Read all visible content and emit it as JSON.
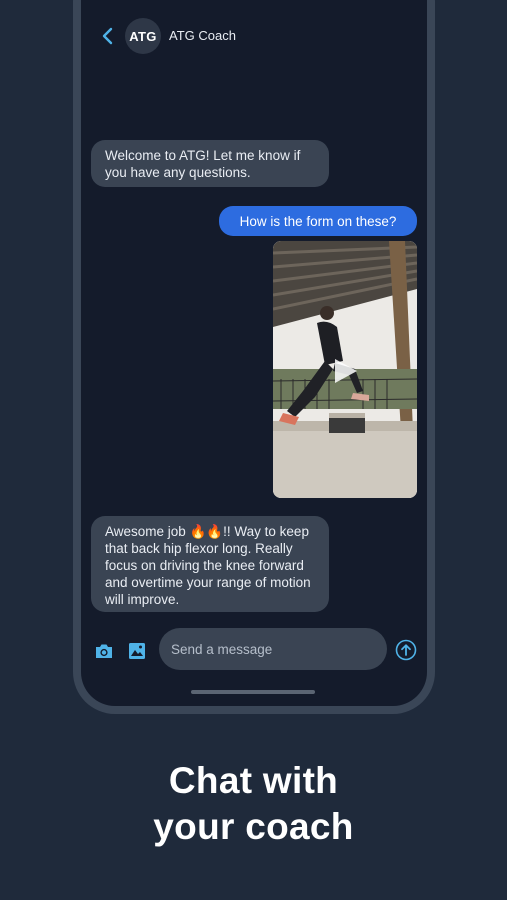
{
  "header": {
    "avatar_text": "ATG",
    "coach_name": "ATG Coach"
  },
  "messages": [
    {
      "sender": "coach",
      "text": "Welcome to ATG! Let me know if you have any questions."
    },
    {
      "sender": "user",
      "text": "How is the form on these?"
    },
    {
      "sender": "user",
      "type": "video"
    },
    {
      "sender": "coach",
      "text": "Awesome job 🔥🔥!! Way to keep that back hip flexor long. Really focus on driving the knee forward and overtime your range of motion will improve."
    }
  ],
  "composer": {
    "placeholder": "Send a message"
  },
  "caption": {
    "line1": "Chat with",
    "line2": "your coach"
  },
  "colors": {
    "background": "#1f2a3b",
    "screen": "#141b2b",
    "incoming_bubble": "#3a4453",
    "outgoing_bubble": "#2d6ce0",
    "accent_icon": "#4fb3e8"
  }
}
